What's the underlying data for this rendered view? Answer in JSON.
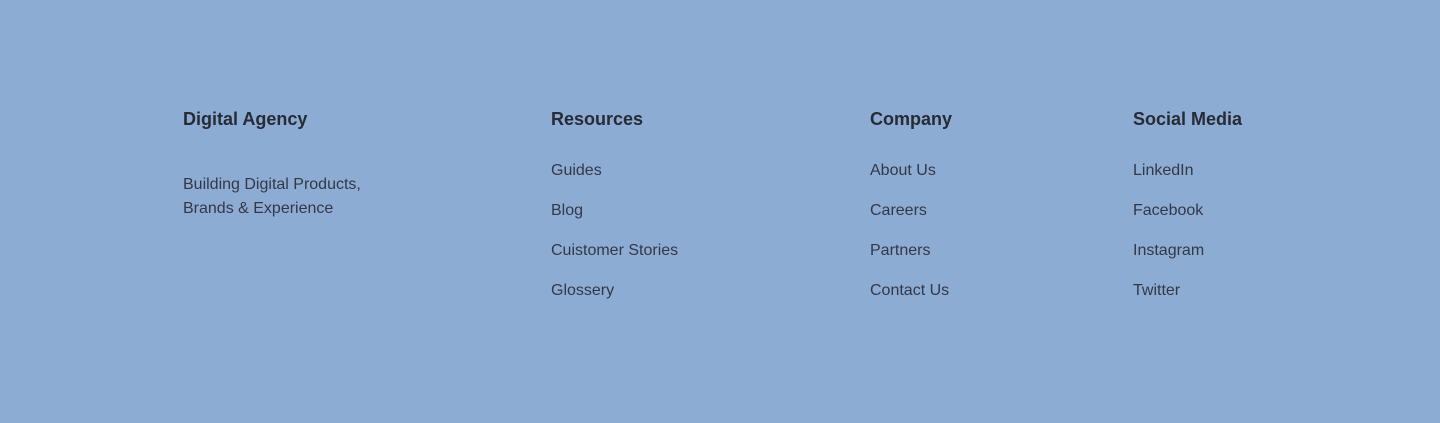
{
  "brand": {
    "title": "Digital Agency",
    "tagline_line1": "Building Digital Products,",
    "tagline_line2": "Brands & Experience"
  },
  "resources": {
    "title": "Resources",
    "links": [
      "Guides",
      "Blog",
      "Cuistomer Stories",
      "Glossery"
    ]
  },
  "company": {
    "title": "Company",
    "links": [
      "About Us",
      "Careers",
      "Partners",
      "Contact Us"
    ]
  },
  "social": {
    "title": "Social Media",
    "links": [
      "LinkedIn",
      "Facebook",
      "Instagram",
      "Twitter"
    ]
  },
  "colors": {
    "background": "#8dacd4",
    "heading": "#262b35",
    "text": "#333846"
  }
}
